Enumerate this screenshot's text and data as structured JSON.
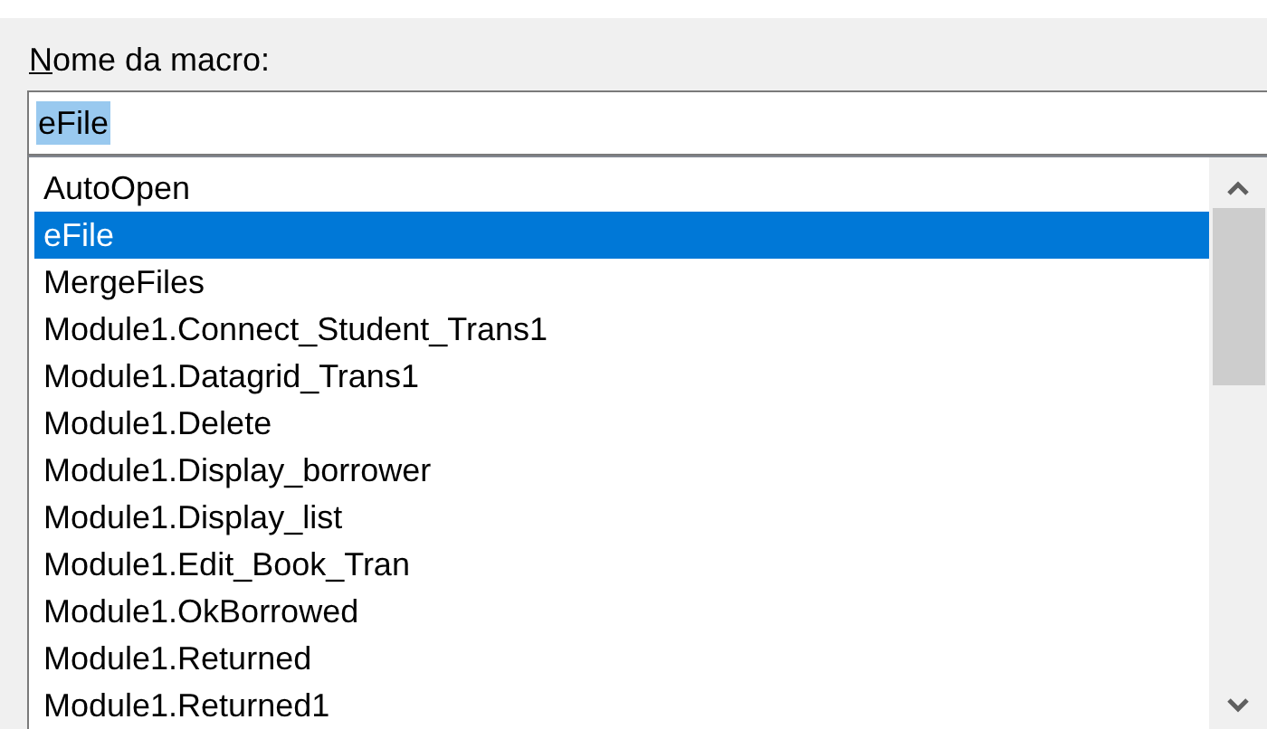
{
  "macro_name": {
    "label": "Nome da macro:",
    "value": "eFile",
    "value_selected": true
  },
  "macro_list": [
    {
      "name": "AutoOpen",
      "selected": false
    },
    {
      "name": "eFile",
      "selected": true
    },
    {
      "name": "MergeFiles",
      "selected": false
    },
    {
      "name": "Module1.Connect_Student_Trans1",
      "selected": false
    },
    {
      "name": "Module1.Datagrid_Trans1",
      "selected": false
    },
    {
      "name": "Module1.Delete",
      "selected": false
    },
    {
      "name": "Module1.Display_borrower",
      "selected": false
    },
    {
      "name": "Module1.Display_list",
      "selected": false
    },
    {
      "name": "Module1.Edit_Book_Tran",
      "selected": false
    },
    {
      "name": "Module1.OkBorrowed",
      "selected": false
    },
    {
      "name": "Module1.Returned",
      "selected": false
    },
    {
      "name": "Module1.Returned1",
      "selected": false
    }
  ]
}
